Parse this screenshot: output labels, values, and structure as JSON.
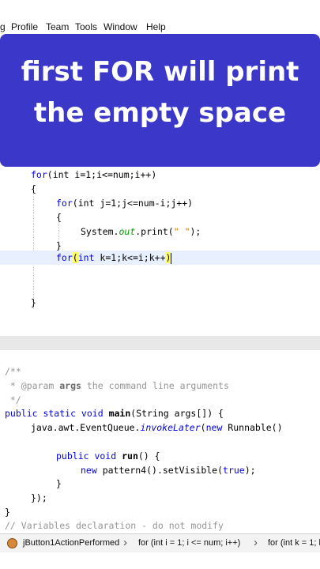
{
  "menu": {
    "items": [
      "g",
      "Profile",
      "Team",
      "Tools",
      "Window",
      "Help"
    ]
  },
  "banner": {
    "line1": "first FOR will print",
    "line2": "the empty space"
  },
  "code_top": {
    "line1_kw": "for",
    "line1_rest": "(int i=1;i<=num;i++)",
    "line2": "{",
    "line3_kw": "for",
    "line3_rest": "(int j=1;j<=num-i;j++)",
    "line4": "{",
    "line5_a": "System.",
    "line5_field": "out",
    "line5_b": ".print(",
    "line5_str": "\" \"",
    "line5_c": ");",
    "line6": "}",
    "line7_kw": "for",
    "line7_paren": "(",
    "line7_int": "int",
    "line7_rest": " k=1;k<=i;k++",
    "line7_close": ")",
    "line8": "}"
  },
  "code_bottom": {
    "c1": "/**",
    "c2_a": " * @param ",
    "c2_b": "args",
    "c2_c": " the command line arguments",
    "c3": " */",
    "m1_kw": "public static void ",
    "m1_fn": "main",
    "m1_rest": "(String args[]) {",
    "m2_a": "java.awt.EventQueue.",
    "m2_it": "invokeLater",
    "m2_b": "(",
    "m2_kw": "new",
    "m2_c": " Runnable()",
    "m3_kw": "public void ",
    "m3_fn": "run",
    "m3_rest": "() {",
    "m4_kw": "new",
    "m4_a": " pattern4().setVisible(",
    "m4_kw2": "true",
    "m4_b": ");",
    "m5": "}",
    "m6": "});",
    "m7": "}",
    "m8": "// Variables declaration - do not modify"
  },
  "statusbar": {
    "crumb1": "jButton1ActionPerformed",
    "crumb2": "for (int i = 1; i <= num; i++)",
    "crumb3": "for (int k = 1; k"
  }
}
